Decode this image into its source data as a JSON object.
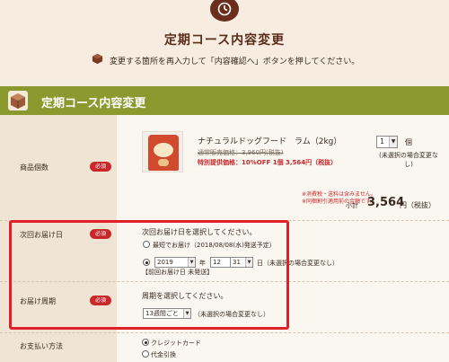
{
  "header": {
    "title": "定期コース内容変更",
    "instruction": "変更する箇所を再入力して「内容確認へ」ボタンを押してください。"
  },
  "section": {
    "title": "定期コース内容変更"
  },
  "form": {
    "required_badge": "必須",
    "quantity_row": {
      "label": "商品個数",
      "product_name": "ナチュラルドッグフード　ラム（2kg）",
      "regular_price": "通常販売価格：3,960円(税抜)",
      "special_price": "特別提供価格：10%OFF 1個 3,564円（税抜）",
      "quantity": "1",
      "unit": "個",
      "quantity_note": "(未選択の場合変更なし)",
      "notes": [
        "※消費税・送料は含みません。",
        "※同梱割引適用前の金額です。"
      ],
      "subtotal_label": "小計",
      "subtotal_value": "3,564",
      "subtotal_unit": "円（税抜）"
    },
    "next_delivery_row": {
      "label": "次回お届け日",
      "heading": "次回お届け日を選択してください。",
      "option_earliest": "最短でお届け（2018/08/08(水)発送予定）",
      "year": "2019",
      "year_unit": "年",
      "month": "12",
      "month_unit": "月",
      "day": "31",
      "day_unit": "日（未選択の場合変更なし）",
      "previous_note": "【前回お届け日 未発送】"
    },
    "cycle_row": {
      "label": "お届け周期",
      "heading": "周期を選択してください。",
      "cycle": "13週間ごと",
      "cycle_note": "（未選択の場合変更なし）"
    },
    "payment_row": {
      "label": "お支払い方法",
      "option_credit": "クレジットカード",
      "option_cod": "代金引換"
    }
  },
  "colors": {
    "banner": "#8a9a2e",
    "required": "#c8282a",
    "highlight_box": "#e0212a",
    "title": "#5a2c1a"
  }
}
